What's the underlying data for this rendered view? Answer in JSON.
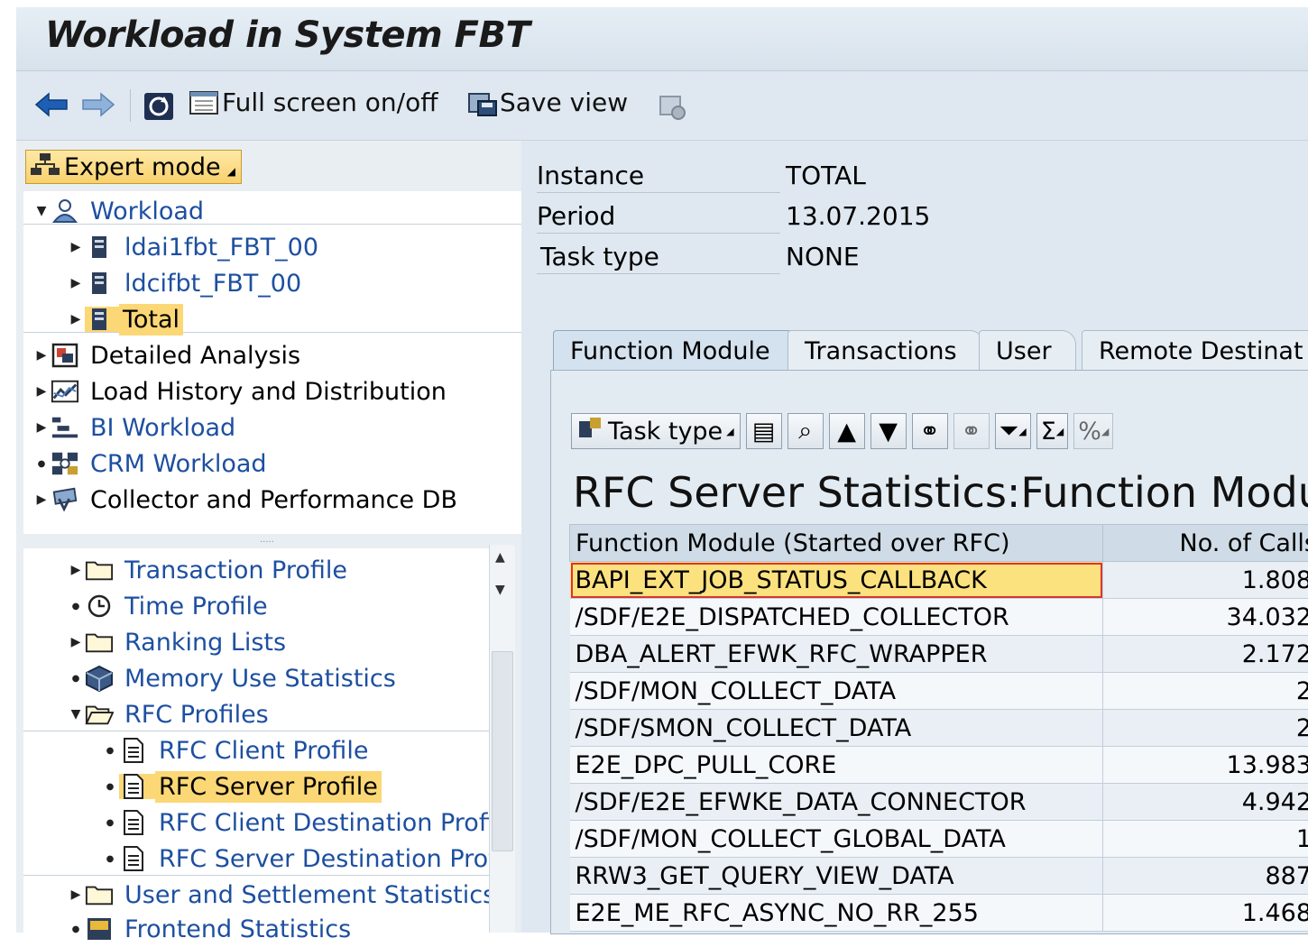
{
  "window": {
    "title": "Workload in System FBT"
  },
  "toolbar": {
    "back_icon": "back-arrow-icon",
    "forward_icon": "forward-arrow-icon",
    "full_screen_label": "Full screen on/off",
    "save_view_label": "Save view"
  },
  "left": {
    "expert_mode_label": "Expert mode",
    "top_tree": [
      {
        "label": "Workload",
        "icon": "workload-icon"
      },
      {
        "label": "ldai1fbt_FBT_00",
        "icon": "server-icon"
      },
      {
        "label": "ldcifbt_FBT_00",
        "icon": "server-icon"
      },
      {
        "label": "Total",
        "icon": "server-icon"
      },
      {
        "label": "Detailed Analysis",
        "icon": "analysis-icon"
      },
      {
        "label": "Load History and Distribution",
        "icon": "chart-icon"
      },
      {
        "label": "BI Workload",
        "icon": "bi-icon"
      },
      {
        "label": "CRM Workload",
        "icon": "crm-icon"
      },
      {
        "label": "Collector and Performance DB",
        "icon": "collector-icon"
      }
    ],
    "bottom_tree": [
      {
        "label": "Transaction Profile",
        "icon": "folder-icon"
      },
      {
        "label": "Time Profile",
        "icon": "clock-icon"
      },
      {
        "label": "Ranking Lists",
        "icon": "folder-icon"
      },
      {
        "label": "Memory Use Statistics",
        "icon": "cube-icon"
      },
      {
        "label": "RFC Profiles",
        "icon": "folder-open-icon"
      },
      {
        "label": "RFC Client Profile",
        "icon": "document-icon"
      },
      {
        "label": "RFC Server Profile",
        "icon": "document-icon"
      },
      {
        "label": "RFC Client Destination Profi",
        "icon": "document-icon"
      },
      {
        "label": "RFC Server Destination Prof",
        "icon": "document-icon"
      },
      {
        "label": "User and Settlement Statistics",
        "icon": "folder-icon"
      },
      {
        "label": "Frontend Statistics",
        "icon": "frontend-icon"
      }
    ]
  },
  "info": {
    "instance_label": "Instance",
    "instance_value": "TOTAL",
    "period_label": "Period",
    "period_value": "13.07.2015",
    "task_type_label": "Task type",
    "task_type_value": "NONE"
  },
  "tabs": [
    "Function Module",
    "Transactions",
    "User",
    "Remote Destinat"
  ],
  "alv": {
    "task_type_button": "Task type",
    "title": "RFC Server Statistics:Function Module",
    "columns": [
      "Function Module (Started over RFC)",
      "No. of Calls"
    ],
    "rows": [
      {
        "name": "BAPI_EXT_JOB_STATUS_CALLBACK",
        "calls": "1.808"
      },
      {
        "name": "/SDF/E2E_DISPATCHED_COLLECTOR",
        "calls": "34.032"
      },
      {
        "name": "DBA_ALERT_EFWK_RFC_WRAPPER",
        "calls": "2.172"
      },
      {
        "name": "/SDF/MON_COLLECT_DATA",
        "calls": "2"
      },
      {
        "name": "/SDF/SMON_COLLECT_DATA",
        "calls": "2"
      },
      {
        "name": "E2E_DPC_PULL_CORE",
        "calls": "13.983"
      },
      {
        "name": "/SDF/E2E_EFWKE_DATA_CONNECTOR",
        "calls": "4.942"
      },
      {
        "name": "/SDF/MON_COLLECT_GLOBAL_DATA",
        "calls": "1"
      },
      {
        "name": "RRW3_GET_QUERY_VIEW_DATA",
        "calls": "887"
      },
      {
        "name": "E2E_ME_RFC_ASYNC_NO_RR_255",
        "calls": "1.468"
      }
    ]
  },
  "colors": {
    "selection": "#fbd776",
    "link": "#1d4fa0"
  }
}
